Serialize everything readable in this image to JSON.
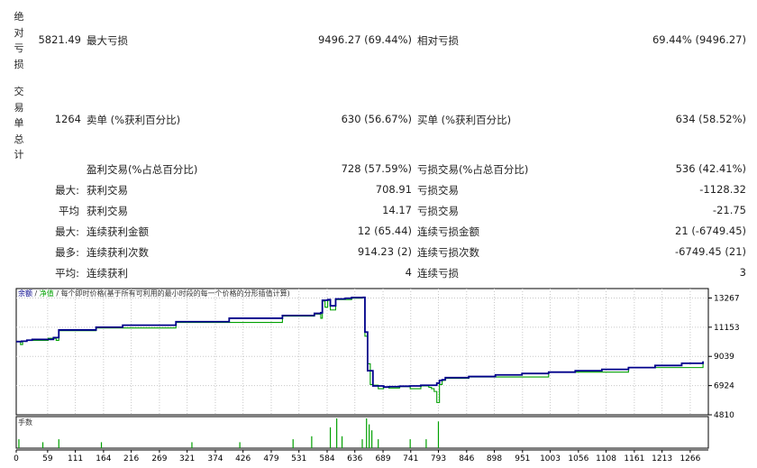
{
  "side_labels": {
    "top": [
      "绝",
      "对",
      "亏",
      "损"
    ],
    "bottom": [
      "交",
      "易",
      "单",
      "总",
      "计"
    ]
  },
  "stats": {
    "absolute_drawdown_value": "5821.49",
    "max_drawdown_label": "最大亏损",
    "max_drawdown_value": "9496.27 (69.44%)",
    "relative_drawdown_label": "相对亏损",
    "relative_drawdown_value": "69.44% (9496.27)",
    "total_trades_value": "1264",
    "short_label": "卖单 (%获利百分比)",
    "short_value": "630 (56.67%)",
    "long_label": "买单 (%获利百分比)",
    "long_value": "634 (58.52%)",
    "profit_trades_label": "盈利交易(%占总百分比)",
    "profit_trades_value": "728 (57.59%)",
    "loss_trades_label": "亏损交易(%占总百分比)",
    "loss_trades_value": "536 (42.41%)",
    "rows": [
      {
        "prefix": "最大:",
        "l_label": "获利交易",
        "l_value": "708.91",
        "r_label": "亏损交易",
        "r_value": "-1128.32"
      },
      {
        "prefix": "平均",
        "l_label": "获利交易",
        "l_value": "14.17",
        "r_label": "亏损交易",
        "r_value": "-21.75"
      },
      {
        "prefix": "最大:",
        "l_label": "连续获利金额",
        "l_value": "12 (65.44)",
        "r_label": "连续亏损金额",
        "r_value": "21 (-6749.45)"
      },
      {
        "prefix": "最多:",
        "l_label": "连续获利次数",
        "l_value": "914.23 (2)",
        "r_label": "连续亏损次数",
        "r_value": "-6749.45 (21)"
      },
      {
        "prefix": "平均:",
        "l_label": "连续获利",
        "l_value": "4",
        "r_label": "连续亏损",
        "r_value": "3"
      }
    ]
  },
  "chart": {
    "legend_balance": "余额",
    "legend_sep": " / ",
    "legend_equity": "净值",
    "legend_desc": " / 每个即时价格(基于所有可利用的最小时段的每一个价格的分形插值计算)",
    "volume_label": "手数",
    "balance_color": "#00008b",
    "equity_color": "#00a000",
    "volume_color": "#00a000",
    "y_ticks": [
      "13267",
      "11153",
      "9039",
      "6924",
      "4810"
    ],
    "x_ticks": [
      "0",
      "59",
      "111",
      "164",
      "216",
      "269",
      "321",
      "374",
      "426",
      "479",
      "531",
      "584",
      "636",
      "689",
      "741",
      "793",
      "846",
      "898",
      "951",
      "1003",
      "1056",
      "1108",
      "1161",
      "1213",
      "1266"
    ]
  },
  "chart_data": {
    "type": "line",
    "title": "",
    "xlabel": "",
    "ylabel": "",
    "ylim": [
      4810,
      13950
    ],
    "xlim": [
      0,
      1300
    ],
    "grid": true,
    "series": [
      {
        "name": "余额",
        "x": [
          0,
          10,
          20,
          30,
          70,
          80,
          150,
          200,
          300,
          400,
          500,
          560,
          572,
          575,
          585,
          590,
          600,
          618,
          630,
          652,
          655,
          660,
          670,
          690,
          700,
          720,
          740,
          760,
          790,
          795,
          800,
          806,
          850,
          900,
          950,
          1000,
          1050,
          1100,
          1150,
          1200,
          1250,
          1290
        ],
        "y": [
          10110,
          10140,
          10210,
          10270,
          10400,
          10950,
          11150,
          11300,
          11550,
          11800,
          12000,
          12150,
          12200,
          13100,
          13150,
          12700,
          13200,
          13250,
          13300,
          13310,
          10800,
          8000,
          6900,
          6820,
          6850,
          6880,
          6900,
          6950,
          7100,
          7300,
          7350,
          7500,
          7580,
          7700,
          7800,
          7900,
          8000,
          8100,
          8230,
          8380,
          8540,
          8680
        ]
      },
      {
        "name": "净值",
        "x": [
          0,
          8,
          12,
          20,
          60,
          75,
          80,
          150,
          300,
          500,
          560,
          572,
          575,
          580,
          585,
          590,
          600,
          630,
          650,
          655,
          660,
          665,
          670,
          680,
          690,
          700,
          720,
          740,
          760,
          775,
          780,
          785,
          790,
          795,
          800,
          806,
          850,
          1000,
          1150,
          1290
        ],
        "y": [
          10100,
          9900,
          10150,
          10200,
          10350,
          10200,
          10900,
          11100,
          11500,
          11950,
          12100,
          11800,
          13050,
          12600,
          13100,
          12400,
          13150,
          13250,
          13300,
          10500,
          8500,
          7000,
          6950,
          6700,
          6800,
          6750,
          6850,
          6700,
          6900,
          6800,
          6700,
          6500,
          5700,
          7000,
          7300,
          7450,
          7550,
          7900,
          8230,
          8680
        ]
      }
    ],
    "volume": {
      "x": [
        5,
        50,
        80,
        160,
        330,
        420,
        520,
        555,
        590,
        602,
        612,
        650,
        658,
        663,
        668,
        680,
        740,
        770,
        793
      ],
      "values": [
        0.3,
        0.2,
        0.3,
        0.2,
        0.2,
        0.2,
        0.3,
        0.4,
        0.7,
        1.0,
        0.4,
        0.3,
        1.0,
        0.8,
        0.6,
        0.3,
        0.3,
        0.3,
        0.9
      ]
    }
  }
}
